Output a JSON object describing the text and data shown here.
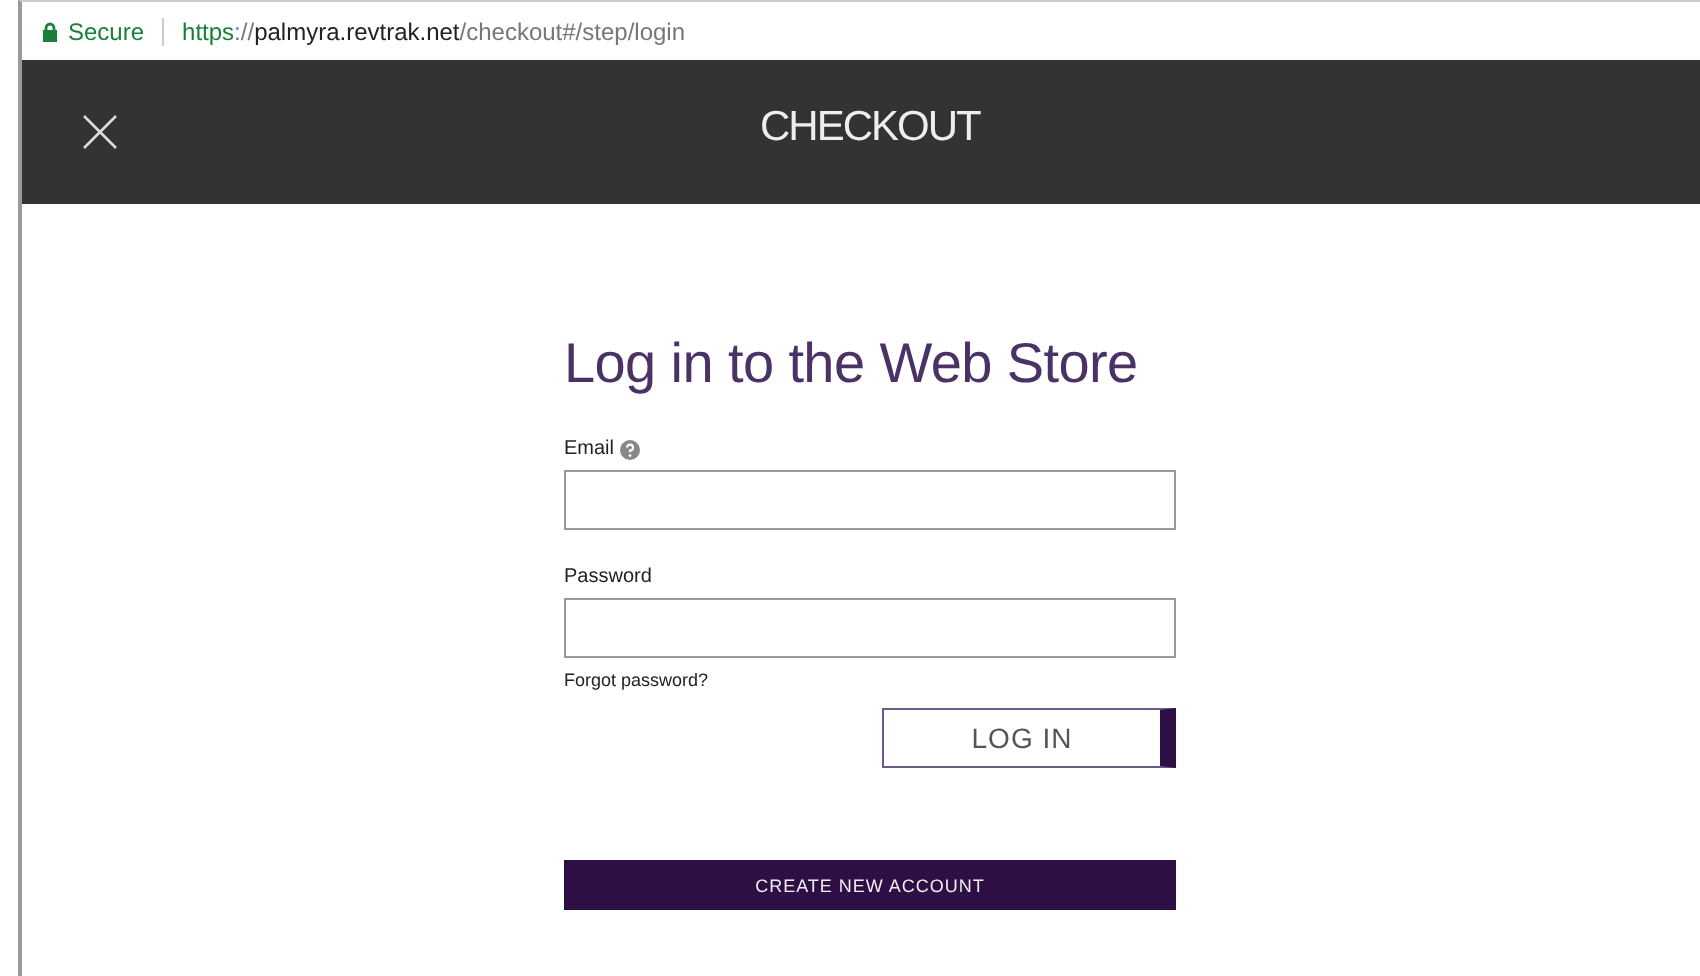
{
  "address_bar": {
    "secure_label": "Secure",
    "url": {
      "scheme": "https",
      "separator": "://",
      "host": "palmyra.revtrak.net",
      "path": "/checkout#/step/login"
    }
  },
  "header": {
    "title": "CHECKOUT"
  },
  "form": {
    "heading": "Log in to the Web Store",
    "fields": [
      {
        "label": "Email",
        "help": true
      },
      {
        "label": "Password",
        "help": false
      }
    ],
    "forgot_link": "Forgot password?",
    "login_button": "LOG IN",
    "create_button": "CREATE NEW ACCOUNT"
  }
}
